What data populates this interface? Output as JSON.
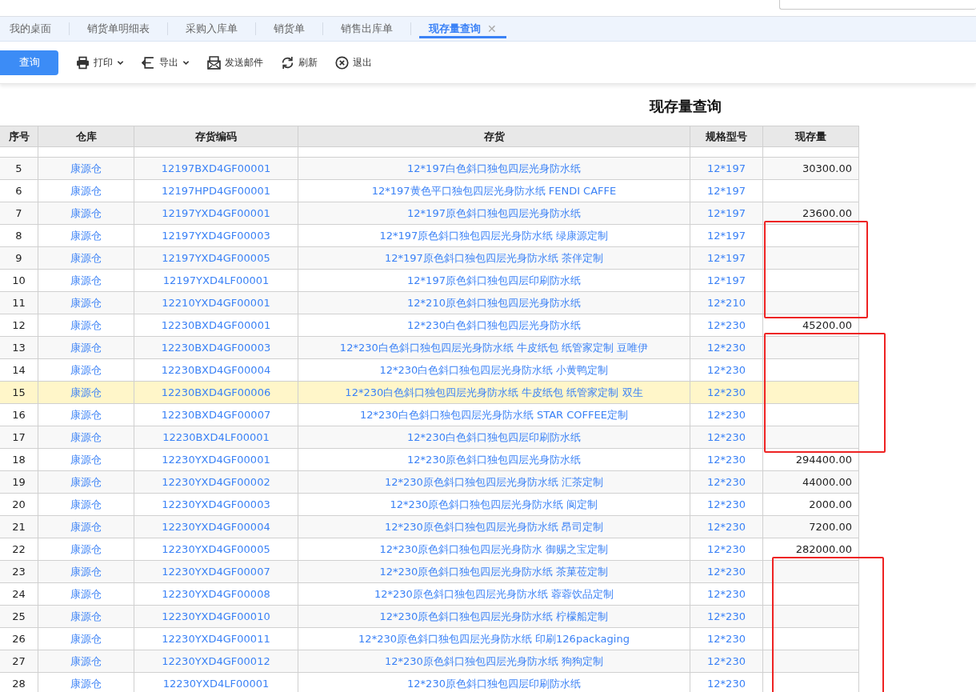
{
  "tabs": [
    {
      "label": "我的桌面",
      "selected": false,
      "closable": false
    },
    {
      "label": "销货单明细表",
      "selected": false,
      "closable": false
    },
    {
      "label": "采购入库单",
      "selected": false,
      "closable": false
    },
    {
      "label": "销货单",
      "selected": false,
      "closable": false
    },
    {
      "label": "销售出库单",
      "selected": false,
      "closable": false
    },
    {
      "label": "现存量查询",
      "selected": true,
      "closable": true,
      "close": "✕"
    }
  ],
  "toolbar": [
    {
      "kind": "primary",
      "label": "查询"
    },
    {
      "kind": "print",
      "label": "打印",
      "dropdown": true
    },
    {
      "kind": "export",
      "label": "导出",
      "dropdown": true
    },
    {
      "kind": "mail",
      "label": "发送邮件",
      "dropdown": false
    },
    {
      "kind": "refresh",
      "label": "刷新",
      "dropdown": false
    },
    {
      "kind": "exit",
      "label": "退出",
      "dropdown": false
    }
  ],
  "report_title": "现存量查询",
  "table": {
    "columns": [
      "序号",
      "仓库",
      "存货编码",
      "存货",
      "规格型号",
      "现存量"
    ],
    "rows": [
      {
        "no": "5",
        "warehouse": "康源仓",
        "code": "12197BXD4GF00001",
        "item": "12*197白色斜口独包四层光身防水纸",
        "spec": "12*197",
        "qty": "30300.00",
        "selected": false,
        "outlined": false
      },
      {
        "no": "6",
        "warehouse": "康源仓",
        "code": "12197HPD4GF00001",
        "item": "12*197黄色平口独包四层光身防水纸 FENDI CAFFE",
        "spec": "12*197",
        "qty": "",
        "selected": false,
        "outlined": false
      },
      {
        "no": "7",
        "warehouse": "康源仓",
        "code": "12197YXD4GF00001",
        "item": "12*197原色斜口独包四层光身防水纸",
        "spec": "12*197",
        "qty": "23600.00",
        "selected": false,
        "outlined": false
      },
      {
        "no": "8",
        "warehouse": "康源仓",
        "code": "12197YXD4GF00003",
        "item": "12*197原色斜口独包四层光身防水纸 绿康源定制",
        "spec": "12*197",
        "qty": "",
        "selected": false,
        "outlined": true
      },
      {
        "no": "9",
        "warehouse": "康源仓",
        "code": "12197YXD4GF00005",
        "item": "12*197原色斜口独包四层光身防水纸 茶伴定制",
        "spec": "12*197",
        "qty": "",
        "selected": false,
        "outlined": true
      },
      {
        "no": "10",
        "warehouse": "康源仓",
        "code": "12197YXD4LF00001",
        "item": "12*197原色斜口独包四层印刷防水纸",
        "spec": "12*197",
        "qty": "",
        "selected": false,
        "outlined": true
      },
      {
        "no": "11",
        "warehouse": "康源仓",
        "code": "12210YXD4GF00001",
        "item": "12*210原色斜口独包四层光身防水纸",
        "spec": "12*210",
        "qty": "",
        "selected": false,
        "outlined": true
      },
      {
        "no": "12",
        "warehouse": "康源仓",
        "code": "12230BXD4GF00001",
        "item": "12*230白色斜口独包四层光身防水纸",
        "spec": "12*230",
        "qty": "45200.00",
        "selected": false,
        "outlined": false
      },
      {
        "no": "13",
        "warehouse": "康源仓",
        "code": "12230BXD4GF00003",
        "item": "12*230白色斜口独包四层光身防水纸 牛皮纸包 纸管家定制 豆唯伊",
        "spec": "12*230",
        "qty": "",
        "selected": false,
        "outlined": true
      },
      {
        "no": "14",
        "warehouse": "康源仓",
        "code": "12230BXD4GF00004",
        "item": "12*230白色斜口独包四层光身防水纸 小黄鸭定制",
        "spec": "12*230",
        "qty": "",
        "selected": false,
        "outlined": true
      },
      {
        "no": "15",
        "warehouse": "康源仓",
        "code": "12230BXD4GF00006",
        "item": "12*230白色斜口独包四层光身防水纸 牛皮纸包 纸管家定制 双生",
        "spec": "12*230",
        "qty": "",
        "selected": true,
        "outlined": true
      },
      {
        "no": "16",
        "warehouse": "康源仓",
        "code": "12230BXD4GF00007",
        "item": "12*230白色斜口独包四层光身防水纸 STAR COFFEE定制",
        "spec": "12*230",
        "qty": "",
        "selected": false,
        "outlined": true
      },
      {
        "no": "17",
        "warehouse": "康源仓",
        "code": "12230BXD4LF00001",
        "item": "12*230白色斜口独包四层印刷防水纸",
        "spec": "12*230",
        "qty": "",
        "selected": false,
        "outlined": true
      },
      {
        "no": "18",
        "warehouse": "康源仓",
        "code": "12230YXD4GF00001",
        "item": "12*230原色斜口独包四层光身防水纸",
        "spec": "12*230",
        "qty": "294400.00",
        "selected": false,
        "outlined": false
      },
      {
        "no": "19",
        "warehouse": "康源仓",
        "code": "12230YXD4GF00002",
        "item": "12*230原色斜口独包四层光身防水纸 汇茶定制",
        "spec": "12*230",
        "qty": "44000.00",
        "selected": false,
        "outlined": false
      },
      {
        "no": "20",
        "warehouse": "康源仓",
        "code": "12230YXD4GF00003",
        "item": "12*230原色斜口独包四层光身防水纸 阆定制",
        "spec": "12*230",
        "qty": "2000.00",
        "selected": false,
        "outlined": false
      },
      {
        "no": "21",
        "warehouse": "康源仓",
        "code": "12230YXD4GF00004",
        "item": "12*230原色斜口独包四层光身防水纸 昂司定制",
        "spec": "12*230",
        "qty": "7200.00",
        "selected": false,
        "outlined": false
      },
      {
        "no": "22",
        "warehouse": "康源仓",
        "code": "12230YXD4GF00005",
        "item": "12*230原色斜口独包四层光身防水 御赐之宝定制",
        "spec": "12*230",
        "qty": "282000.00",
        "selected": false,
        "outlined": false
      },
      {
        "no": "23",
        "warehouse": "康源仓",
        "code": "12230YXD4GF00007",
        "item": "12*230原色斜口独包四层光身防水纸 茶菓莅定制",
        "spec": "12*230",
        "qty": "",
        "selected": false,
        "outlined": true
      },
      {
        "no": "24",
        "warehouse": "康源仓",
        "code": "12230YXD4GF00008",
        "item": "12*230原色斜口独包四层光身防水纸 蓉蓉饮品定制",
        "spec": "12*230",
        "qty": "",
        "selected": false,
        "outlined": true
      },
      {
        "no": "25",
        "warehouse": "康源仓",
        "code": "12230YXD4GF00010",
        "item": "12*230原色斜口独包四层光身防水纸 柠檬船定制",
        "spec": "12*230",
        "qty": "",
        "selected": false,
        "outlined": true
      },
      {
        "no": "26",
        "warehouse": "康源仓",
        "code": "12230YXD4GF00011",
        "item": "12*230原色斜口独包四层光身防水纸 印刷126packaging",
        "spec": "12*230",
        "qty": "",
        "selected": false,
        "outlined": true
      },
      {
        "no": "27",
        "warehouse": "康源仓",
        "code": "12230YXD4GF00012",
        "item": "12*230原色斜口独包四层光身防水纸 狗狗定制",
        "spec": "12*230",
        "qty": "",
        "selected": false,
        "outlined": true
      },
      {
        "no": "28",
        "warehouse": "康源仓",
        "code": "12230YXD4LF00001",
        "item": "12*230原色斜口独包四层印刷防水纸",
        "spec": "12*230",
        "qty": "",
        "selected": false,
        "outlined": true
      }
    ]
  }
}
